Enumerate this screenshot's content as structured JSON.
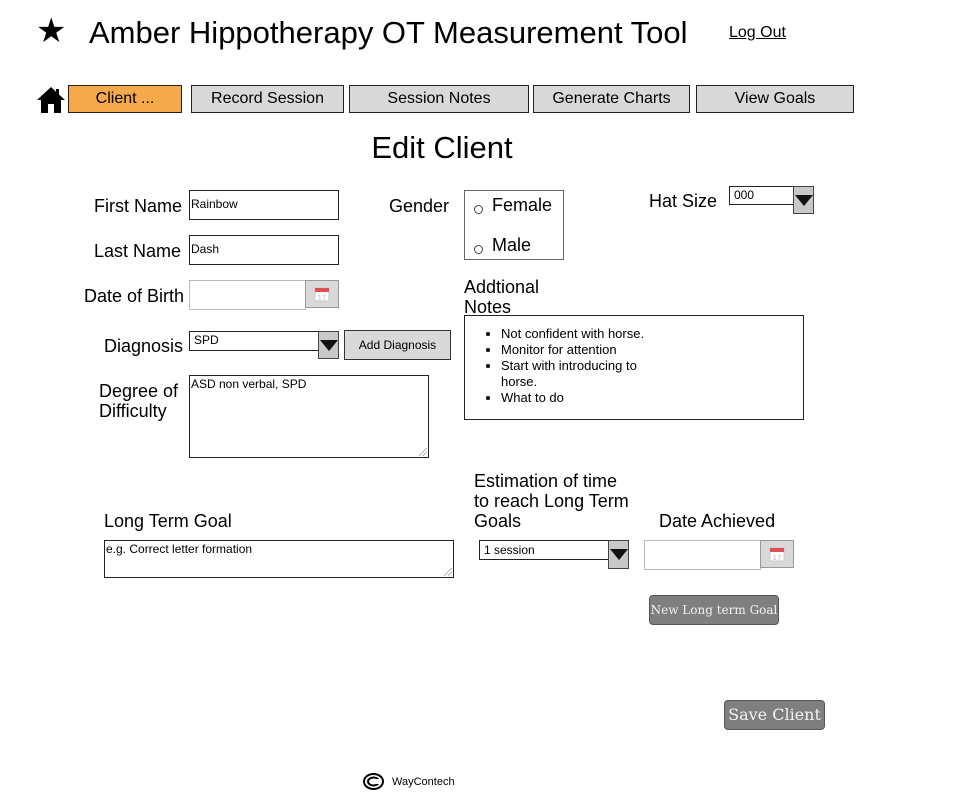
{
  "header": {
    "title": "Amber Hippotherapy OT Measurement Tool",
    "logout_label": "Log Out"
  },
  "icons": {
    "star": "star-icon",
    "home": "home-icon",
    "calendar": "calendar-icon",
    "dropdown": "triangle-down-icon",
    "copyright": "copyright-icon"
  },
  "nav": {
    "tabs": [
      {
        "label": "Client ...",
        "active": true
      },
      {
        "label": "Record Session",
        "active": false
      },
      {
        "label": "Session Notes",
        "active": false
      },
      {
        "label": "Generate Charts",
        "active": false
      },
      {
        "label": "View Goals",
        "active": false
      }
    ]
  },
  "colors": {
    "active_tab": "#f5a94a",
    "tab_bg": "#d9d9d9",
    "dark_button": "#7f7f7f"
  },
  "page_title": "Edit Client",
  "form": {
    "first_name": {
      "label": "First Name",
      "value": "Rainbow"
    },
    "last_name": {
      "label": "Last Name",
      "value": "Dash"
    },
    "dob": {
      "label": "Date of Birth",
      "value": ""
    },
    "diagnosis": {
      "label": "Diagnosis",
      "value": "SPD",
      "add_label": "Add Diagnosis"
    },
    "difficulty": {
      "label_line1": "Degree of",
      "label_line2": "Difficulty",
      "value": "ASD non verbal, SPD"
    },
    "gender": {
      "label": "Gender",
      "options": [
        "Female",
        "Male"
      ],
      "selected": null
    },
    "hat_size": {
      "label": "Hat Size",
      "value": "000"
    },
    "notes": {
      "label_line1": "Addtional",
      "label_line2": "Notes",
      "items": [
        "Not confident with horse.",
        "Monitor for attention",
        "Start with introducing to horse.",
        "What to do"
      ]
    },
    "long_term_goal": {
      "label": "Long Term Goal",
      "placeholder": "e.g. Correct letter formation"
    },
    "estimation": {
      "label_line1": "Estimation of time",
      "label_line2": "to reach Long Term",
      "label_line3": "Goals",
      "value": "1 session"
    },
    "date_achieved": {
      "label": "Date Achieved",
      "value": ""
    },
    "new_goal_label": "New Long term Goal",
    "save_label": "Save Client"
  },
  "footer": {
    "company": "WayContech"
  }
}
